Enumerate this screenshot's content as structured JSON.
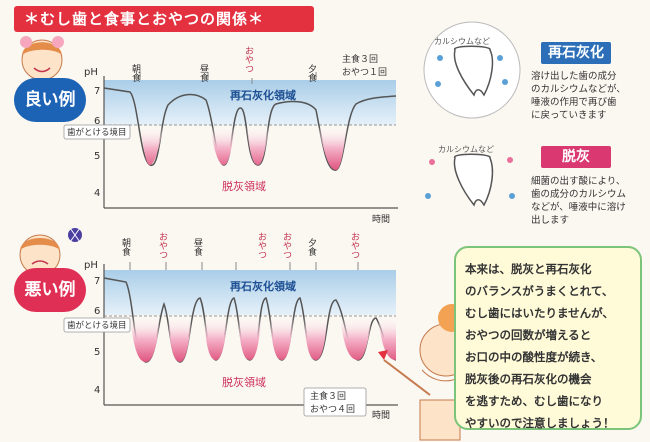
{
  "title": "＊むし歯と食事とおやつの関係＊",
  "good": {
    "label": "良い例",
    "events": [
      "朝食",
      "昼食",
      "おやつ",
      "夕食"
    ],
    "summary": [
      "主食３回",
      "おやつ１回"
    ],
    "threshold": "歯がとける境目",
    "remin_zone": "再石灰化領域",
    "demin_zone": "脱灰領域",
    "time": "時間",
    "ph": "pH",
    "ticks": [
      "7",
      "6",
      "5",
      "4"
    ]
  },
  "bad": {
    "label": "悪い例",
    "events": [
      "朝食",
      "おやつ",
      "昼食",
      "おやつ",
      "おやつ",
      "夕食",
      "おやつ"
    ],
    "summary": [
      "主食３回",
      "おやつ４回"
    ],
    "threshold": "歯がとける境目",
    "remin_zone": "再石灰化領域",
    "demin_zone": "脱灰領域",
    "time": "時間",
    "ph": "pH",
    "ticks": [
      "7",
      "6",
      "5",
      "4"
    ]
  },
  "legend": {
    "remin_title": "再石灰化",
    "remin_lines": [
      "溶け出した歯の成分",
      "のカルシウムなどが、",
      "唾液の作用で再び歯",
      "に戻っていきます"
    ],
    "remin_tooth_label": "カルシウムなど",
    "demin_title": "脱灰",
    "demin_lines": [
      "細菌の出す酸により、",
      "歯の成分のカルシウム",
      "などが、唾液中に溶け",
      "出します"
    ],
    "demin_tooth_label": "カルシウムなど"
  },
  "advice": [
    "本来は、脱灰と再石灰化",
    "のバランスがうまくとれて、",
    "むし歯にはいたりませんが、",
    "おやつの回数が増えると",
    "お口の中の酸性度が続き、",
    "脱灰後の再石灰化の機会",
    "を逃すため、むし歯になり",
    "やすいので注意しましょう！"
  ],
  "colors": {
    "accent_red": "#e3313f",
    "good_blue": "#1d63b5",
    "bad_pink": "#df2f55",
    "remin_band": "#bcd8ec",
    "demin_fill": "#e35f87"
  }
}
